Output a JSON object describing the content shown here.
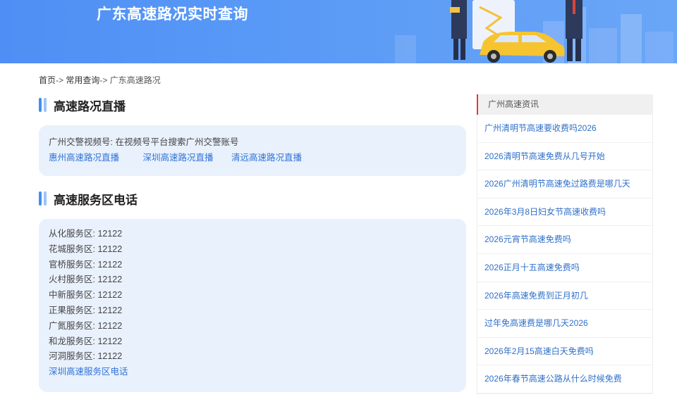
{
  "banner": {
    "title": "广东高速路况实时查询"
  },
  "breadcrumb": {
    "home": "首页",
    "sep1": "->",
    "common": "常用查询",
    "sep2": "->",
    "current": "广东高速路况"
  },
  "live_section": {
    "title": "高速路况直播",
    "info_label": "广州交警视频号",
    "info_text": ": 在视频号平台搜索广州交警账号",
    "links": [
      "惠州高速路况直播",
      "深圳高速路况直播",
      "清远高速路况直播"
    ]
  },
  "service_section": {
    "title": "高速服务区电话",
    "items": [
      "从化服务区: 12122",
      "花城服务区: 12122",
      "官桥服务区: 12122",
      "火村服务区: 12122",
      "中新服务区: 12122",
      "正果服务区: 12122",
      "广氮服务区: 12122",
      "和龙服务区: 12122",
      "河洞服务区: 12122"
    ],
    "more_link": "深圳高速服务区电话"
  },
  "sidebar": {
    "title": "广州高速资讯",
    "items": [
      "广州清明节高速要收费吗2026",
      "2026清明节高速免费从几号开始",
      "2026广州清明节高速免过路费是哪几天",
      "2026年3月8日妇女节高速收费吗",
      "2026元宵节高速免费吗",
      "2026正月十五高速免费吗",
      "2026年高速免费到正月初几",
      "过年免高速费是哪几天2026",
      "2026年2月15高速白天免费吗",
      "2026年春节高速公路从什么时候免费"
    ]
  },
  "colors": {
    "banner": "#4f8ff5",
    "accent_bar": "#3f8ef5",
    "card_bg": "#e9f1fc",
    "link": "#2f73d8",
    "sidebar_marker": "#e23b3b"
  }
}
